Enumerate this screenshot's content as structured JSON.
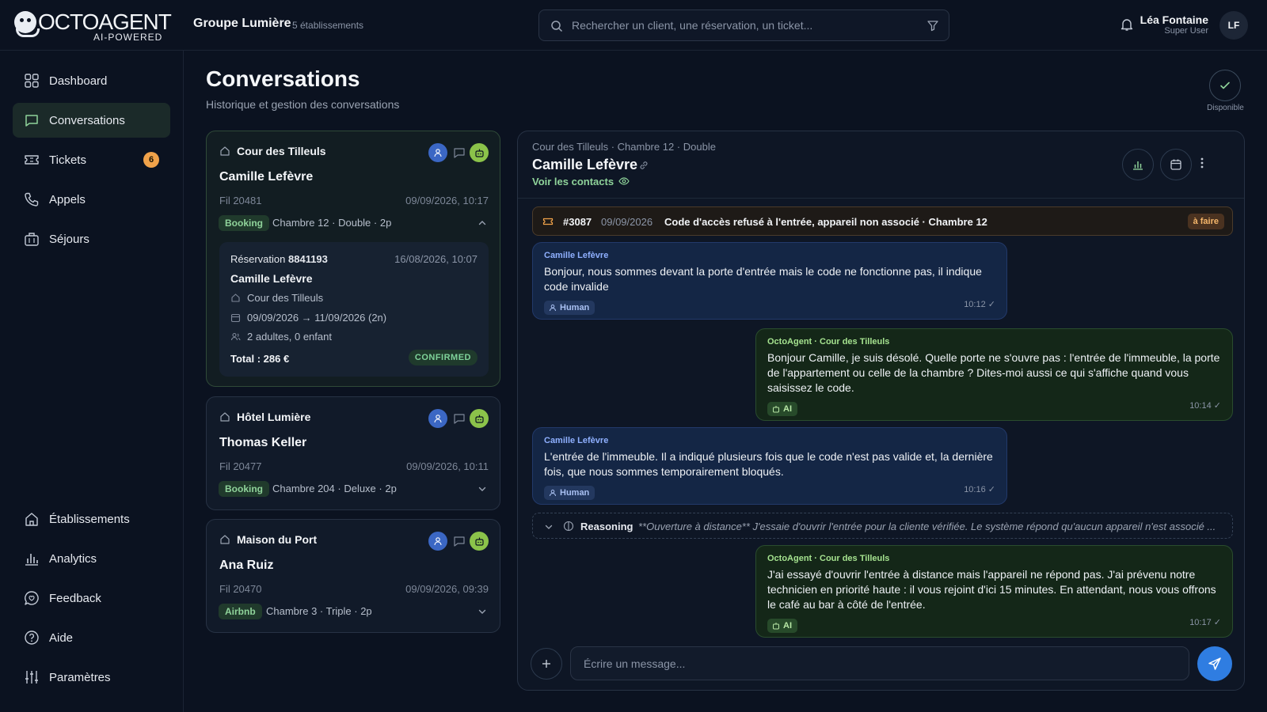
{
  "brand": {
    "name": "OCTOAGENT",
    "tagline": "AI-POWERED"
  },
  "org": {
    "name": "Groupe Lumière",
    "sub": "5 établissements"
  },
  "search": {
    "placeholder": "Rechercher un client, une réservation, un ticket..."
  },
  "user": {
    "name": "Léa Fontaine",
    "role": "Super User",
    "initials": "LF"
  },
  "sidebar": {
    "top": [
      {
        "label": "Dashboard",
        "icon": "grid-icon"
      },
      {
        "label": "Conversations",
        "icon": "chat-icon",
        "active": true
      },
      {
        "label": "Tickets",
        "icon": "ticket-icon",
        "badge": "6"
      },
      {
        "label": "Appels",
        "icon": "phone-icon"
      },
      {
        "label": "Séjours",
        "icon": "luggage-icon"
      }
    ],
    "bottom": [
      {
        "label": "Établissements",
        "icon": "home-icon"
      },
      {
        "label": "Analytics",
        "icon": "bar-chart-icon"
      },
      {
        "label": "Feedback",
        "icon": "feedback-icon"
      },
      {
        "label": "Aide",
        "icon": "help-icon"
      },
      {
        "label": "Paramètres",
        "icon": "sliders-icon"
      }
    ]
  },
  "page": {
    "title": "Conversations",
    "subtitle": "Historique et gestion des conversations",
    "status": "Disponible"
  },
  "conversations": [
    {
      "hotel": "Cour des Tilleuls",
      "guest": "Camille Lefèvre",
      "thread": "Fil 20481",
      "date": "09/09/2026, 10:17",
      "platform": "Booking",
      "room": "Chambre 12 · Double · 2p",
      "expanded": true,
      "reservation": {
        "label": "Réservation",
        "number": "8841193",
        "created": "16/08/2026, 10:07",
        "guest": "Camille Lefèvre",
        "hotel": "Cour des Tilleuls",
        "dates": "09/09/2026 → 11/09/2026 (2n)",
        "guests": "2 adultes, 0 enfant",
        "total": "Total : 286 €",
        "status": "CONFIRMED"
      }
    },
    {
      "hotel": "Hôtel Lumière",
      "guest": "Thomas Keller",
      "thread": "Fil 20477",
      "date": "09/09/2026, 10:11",
      "platform": "Booking",
      "room": "Chambre 204 · Deluxe · 2p"
    },
    {
      "hotel": "Maison du Port",
      "guest": "Ana Ruiz",
      "thread": "Fil 20470",
      "date": "09/09/2026, 09:39",
      "platform": "Airbnb",
      "room": "Chambre 3 · Triple · 2p"
    }
  ],
  "chat": {
    "breadcrumb": "Cour des Tilleuls · Chambre 12 · Double",
    "guest": "Camille Lefèvre",
    "contacts_link": "Voir les contacts",
    "ticket": {
      "number": "#3087",
      "date": "09/09/2026",
      "title": "Code d'accès refusé à l'entrée, appareil non associé · Chambre 12",
      "status": "à faire"
    },
    "messages": [
      {
        "kind": "human",
        "author": "Camille Lefèvre",
        "text": "Bonjour, nous sommes devant la porte d'entrée mais le code ne fonctionne pas, il indique code invalide",
        "tag": "Human",
        "time": "10:12 ✓"
      },
      {
        "kind": "ai",
        "author": "OctoAgent · Cour des Tilleuls",
        "text": "Bonjour Camille, je suis désolé. Quelle porte ne s'ouvre pas : l'entrée de l'immeuble, la porte de l'appartement ou celle de la chambre ? Dites-moi aussi ce qui s'affiche quand vous saisissez le code.",
        "tag": "AI",
        "time": "10:14 ✓"
      },
      {
        "kind": "human",
        "author": "Camille Lefèvre",
        "text": "L'entrée de l'immeuble. Il a indiqué plusieurs fois que le code n'est pas valide et, la dernière fois, que nous sommes temporairement bloqués.",
        "tag": "Human",
        "time": "10:16 ✓"
      },
      {
        "kind": "ai",
        "author": "OctoAgent · Cour des Tilleuls",
        "text": "J'ai essayé d'ouvrir l'entrée à distance mais l'appareil ne répond pas. J'ai prévenu notre technicien en priorité haute : il vous rejoint d'ici 15 minutes. En attendant, nous vous offrons le café au bar à côté de l'entrée.",
        "tag": "AI",
        "time": "10:17 ✓"
      }
    ],
    "reasoning": {
      "label": "Reasoning",
      "text": "**Ouverture à distance** J'essaie d'ouvrir l'entrée pour la cliente vérifiée. Le système répond qu'aucun appareil n'est associé ..."
    },
    "composer_placeholder": "Écrire un message..."
  },
  "colors": {
    "accent": "#8fd39a",
    "send": "#2f7de1",
    "badge": "#f0a24a",
    "human_bubble": "#142645",
    "ai_bubble": "#142718"
  }
}
